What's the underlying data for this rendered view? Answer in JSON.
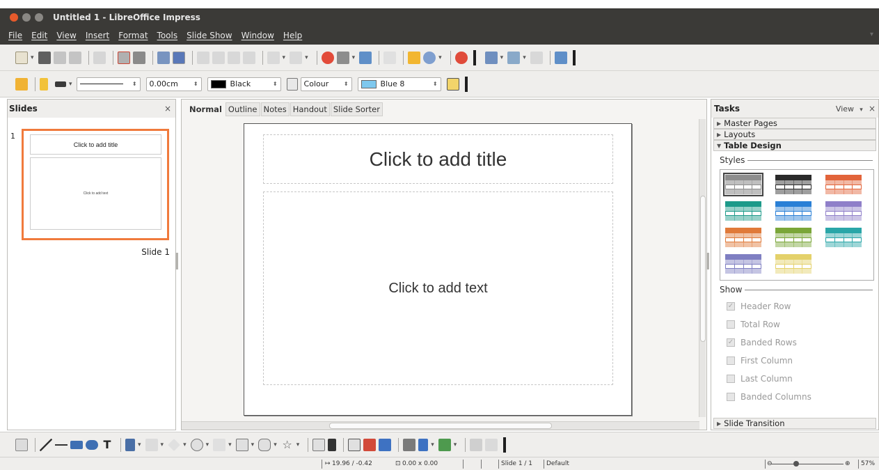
{
  "window": {
    "title": "Untitled 1 - LibreOffice Impress"
  },
  "menu": [
    "File",
    "Edit",
    "View",
    "Insert",
    "Format",
    "Tools",
    "Slide Show",
    "Window",
    "Help"
  ],
  "line_toolbar": {
    "line_width": "0.00cm",
    "line_color": "Black",
    "area_style": "Colour",
    "area_color": "Blue 8",
    "colors": {
      "line": "#000000",
      "area": "#7ec8ee"
    }
  },
  "slides_panel": {
    "title": "Slides",
    "close": "×",
    "slide_number": "1",
    "thumb_title": "Click to add title",
    "thumb_text": "Click to add text",
    "slide_label": "Slide 1"
  },
  "view_tabs": [
    "Normal",
    "Outline",
    "Notes",
    "Handout",
    "Slide Sorter"
  ],
  "slide": {
    "title_placeholder": "Click to add title",
    "text_placeholder": "Click to add text"
  },
  "tasks": {
    "title": "Tasks",
    "view": "View",
    "view_arrow": "▾",
    "close": "×",
    "decks": [
      "Master Pages",
      "Layouts",
      "Table Design"
    ],
    "styles_label": "Styles",
    "show_label": "Show",
    "options": [
      {
        "label": "Header Row",
        "checked": true
      },
      {
        "label": "Total Row",
        "checked": false
      },
      {
        "label": "Banded Rows",
        "checked": true
      },
      {
        "label": "First Column",
        "checked": false
      },
      {
        "label": "Last Column",
        "checked": false
      },
      {
        "label": "Banded Columns",
        "checked": false
      }
    ],
    "transition_deck": "Slide Transition",
    "table_style_colors": [
      "#8d8d8d",
      "#2a2a2a",
      "#e2643a",
      "#1d9a8a",
      "#2a80d6",
      "#8f7fc9",
      "#e07a3a",
      "#7aa638",
      "#2aa6a8",
      "#7f7fc2",
      "#e4d16a"
    ]
  },
  "status": {
    "position": "19.96 / -0.42",
    "size": "0.00 x 0.00",
    "slide": "Slide 1 / 1",
    "master": "Default",
    "zoom": "57%"
  }
}
